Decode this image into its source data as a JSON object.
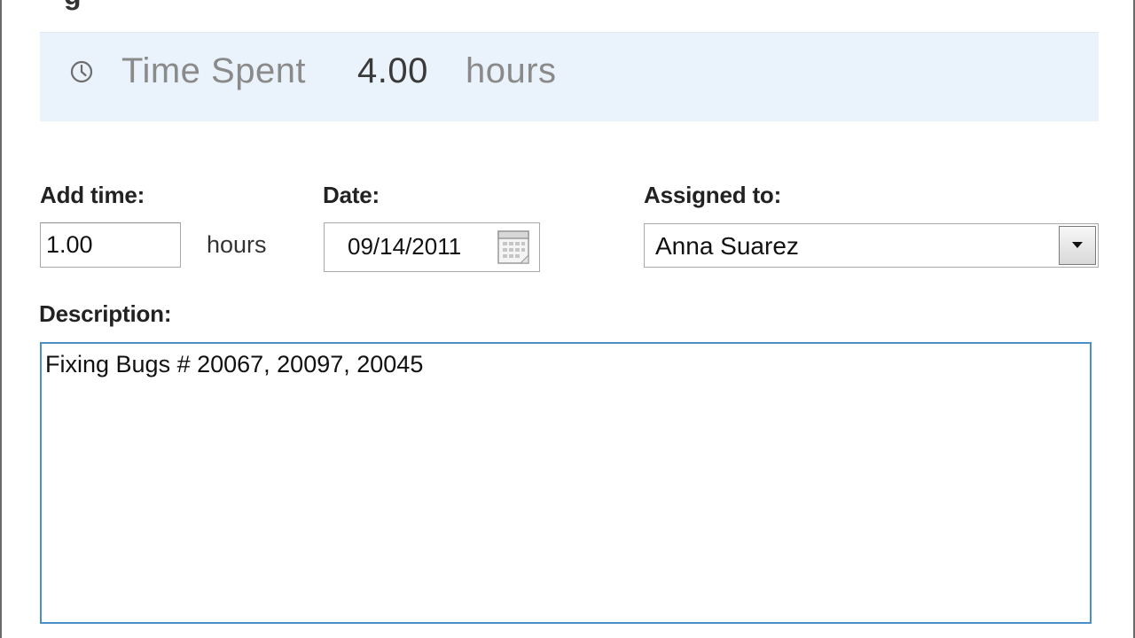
{
  "header": {
    "title_fragment": "g"
  },
  "summary": {
    "icon": "clock-icon",
    "label": "Time Spent",
    "value": "4.00",
    "unit": "hours"
  },
  "form": {
    "add_time": {
      "label": "Add time:",
      "value": "1.00",
      "unit": "hours"
    },
    "date": {
      "label": "Date:",
      "value": "09/14/2011",
      "icon": "calendar-icon"
    },
    "assigned_to": {
      "label": "Assigned to:",
      "selected": "Anna Suarez",
      "icon": "chevron-down-icon"
    },
    "description": {
      "label": "Description:",
      "value": "Fixing Bugs # 20067, 20097, 20045"
    }
  },
  "colors": {
    "summary_background": "#eaf2fb",
    "focus_border": "#4a90c8"
  }
}
